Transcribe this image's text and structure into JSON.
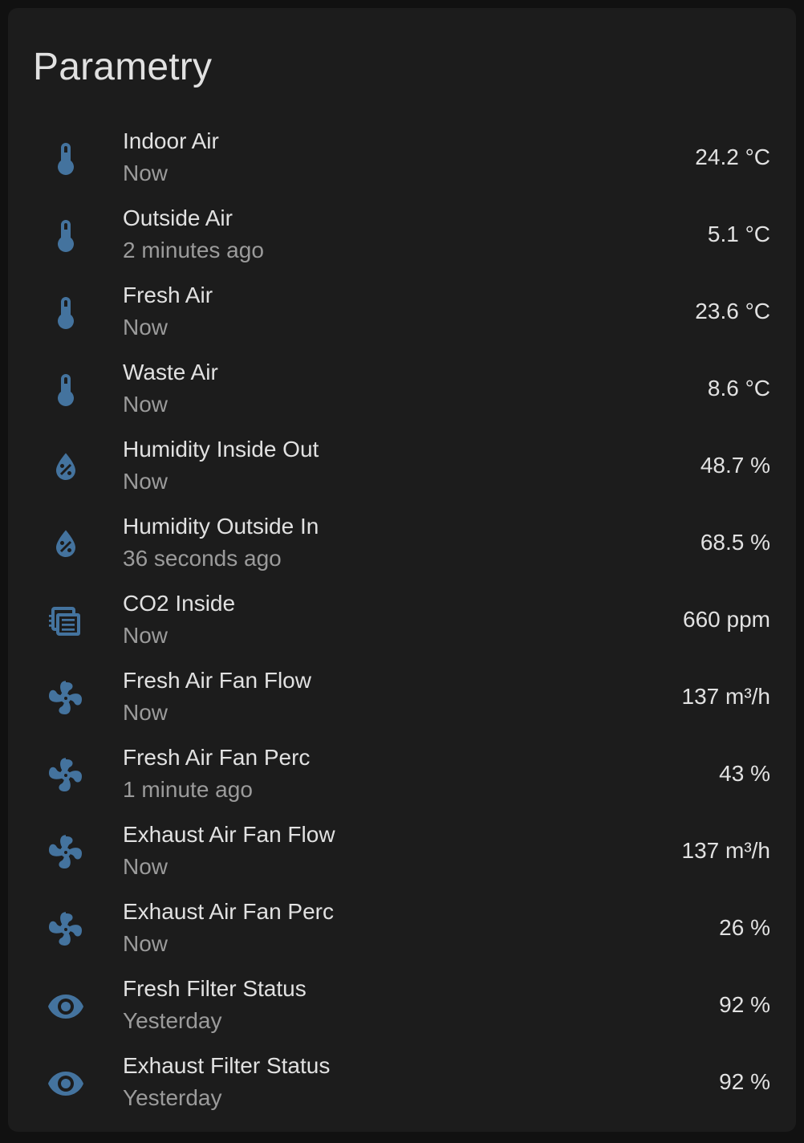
{
  "card": {
    "title": "Parametry"
  },
  "colors": {
    "icon": "#44739e",
    "card_background": "#1c1c1c",
    "page_background": "#111111",
    "primary_text": "#e1e1e1",
    "secondary_text": "#9b9b9b"
  },
  "entities": [
    {
      "icon": "thermometer-icon",
      "name": "Indoor Air",
      "time": "Now",
      "value": "24.2 °C"
    },
    {
      "icon": "thermometer-icon",
      "name": "Outside Air",
      "time": "2 minutes ago",
      "value": "5.1 °C"
    },
    {
      "icon": "thermometer-icon",
      "name": "Fresh Air",
      "time": "Now",
      "value": "23.6 °C"
    },
    {
      "icon": "thermometer-icon",
      "name": "Waste Air",
      "time": "Now",
      "value": "8.6 °C"
    },
    {
      "icon": "water-percent-icon",
      "name": "Humidity Inside Out",
      "time": "Now",
      "value": "48.7 %"
    },
    {
      "icon": "water-percent-icon",
      "name": "Humidity Outside In",
      "time": "36 seconds ago",
      "value": "68.5 %"
    },
    {
      "icon": "molecule-co2-icon",
      "name": "CO2 Inside",
      "time": "Now",
      "value": "660 ppm"
    },
    {
      "icon": "fan-icon",
      "name": "Fresh Air Fan Flow",
      "time": "Now",
      "value": "137 m³/h"
    },
    {
      "icon": "fan-icon",
      "name": "Fresh Air Fan Perc",
      "time": "1 minute ago",
      "value": "43 %"
    },
    {
      "icon": "fan-icon",
      "name": "Exhaust Air Fan Flow",
      "time": "Now",
      "value": "137 m³/h"
    },
    {
      "icon": "fan-icon",
      "name": "Exhaust Air Fan Perc",
      "time": "Now",
      "value": "26 %"
    },
    {
      "icon": "eye-icon",
      "name": "Fresh Filter Status",
      "time": "Yesterday",
      "value": "92 %"
    },
    {
      "icon": "eye-icon",
      "name": "Exhaust Filter Status",
      "time": "Yesterday",
      "value": "92 %"
    }
  ]
}
